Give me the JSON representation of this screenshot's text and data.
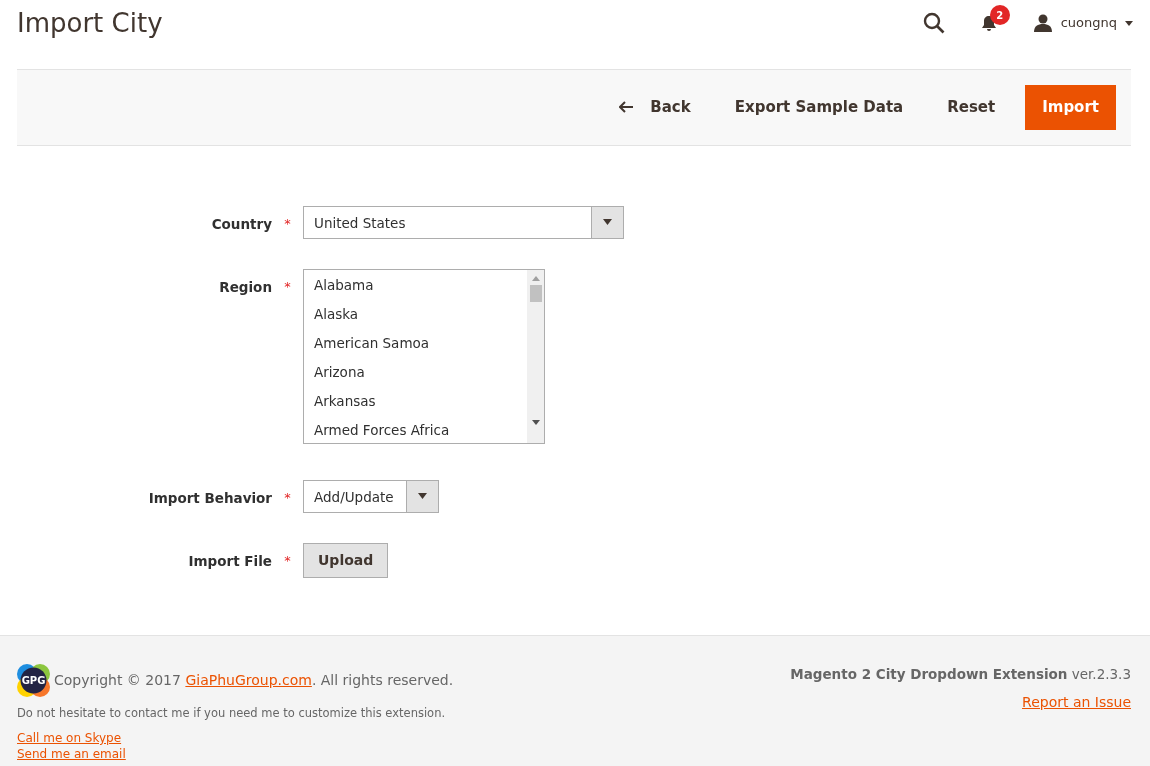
{
  "page_title": "Import City",
  "header": {
    "notification_count": "2",
    "user": "cuongnq"
  },
  "actions": [
    {
      "label": "Back",
      "kind": "back"
    },
    {
      "label": "Export Sample Data",
      "kind": "plain"
    },
    {
      "label": "Reset",
      "kind": "plain"
    },
    {
      "label": "Import",
      "kind": "primary"
    }
  ],
  "fields": [
    {
      "label": "Country",
      "required_mark": "*",
      "kind": "select",
      "value": "United States"
    },
    {
      "label": "Region",
      "required_mark": "*",
      "kind": "listbox",
      "options": [
        "Alabama",
        "Alaska",
        "American Samoa",
        "Arizona",
        "Arkansas",
        "Armed Forces Africa"
      ]
    },
    {
      "label": "Import Behavior",
      "required_mark": "*",
      "kind": "select",
      "value": "Add/Update"
    },
    {
      "label": "Import File",
      "required_mark": "*",
      "kind": "upload",
      "value": "Upload"
    }
  ],
  "footer": {
    "logo_text": "GPG",
    "copyright_prefix": "Copyright © 2017 ",
    "copyright_link": "GiaPhuGroup.com",
    "copyright_suffix": ". All rights reserved.",
    "note": "Do not hesitate to contact me if you need me to customize this extension.",
    "links": [
      "Call me on Skype",
      "Send me an email"
    ],
    "version": "**Magento 2 City Dropdown Extension** ver.2.3.3",
    "report_link": "Report an Issue"
  }
}
